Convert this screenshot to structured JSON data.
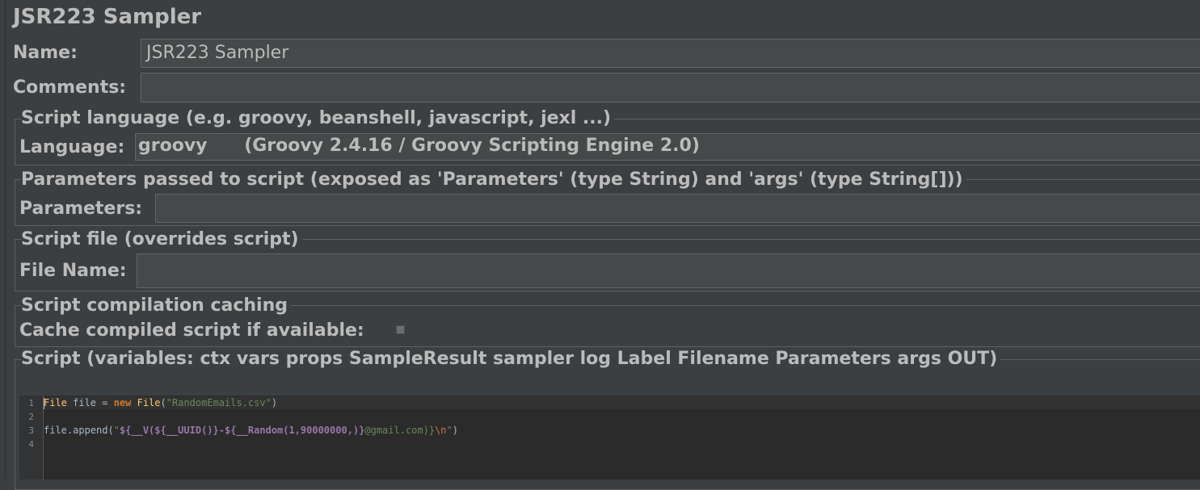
{
  "title": "JSR223 Sampler",
  "name": {
    "label": "Name:",
    "value": "JSR223 Sampler"
  },
  "comments": {
    "label": "Comments:",
    "value": ""
  },
  "language_group": {
    "legend": "Script language (e.g. groovy, beanshell, javascript, jexl ...)",
    "label": "Language:",
    "value": "groovy",
    "engine": "(Groovy 2.4.16 / Groovy Scripting Engine 2.0)"
  },
  "parameters_group": {
    "legend": "Parameters passed to script (exposed as 'Parameters' (type String) and 'args' (type String[]))",
    "label": "Parameters:",
    "value": ""
  },
  "script_file_group": {
    "legend": "Script file (overrides script)",
    "label": "File Name:",
    "value": ""
  },
  "caching_group": {
    "legend": "Script compilation caching",
    "label": "Cache compiled script if available:",
    "checked": false
  },
  "script_group": {
    "legend": "Script (variables: ctx vars props SampleResult sampler log Label Filename Parameters args OUT)"
  },
  "editor": {
    "line_numbers": [
      "1",
      "2",
      "3",
      "4"
    ],
    "line1": {
      "t1": "File",
      "t2": " file = ",
      "t3": "new",
      "t4": " ",
      "t5": "File",
      "t6": "(",
      "t7": "\"RandomEmails.csv\"",
      "t8": ")"
    },
    "line3": {
      "t1": "file.append(",
      "t2": "\"",
      "t3": "${__V(${__UUID()}-${__Random(1,90000000,)}",
      "t4": "@gmail.com)}",
      "t5": "\\n",
      "t6": "\"",
      "t7": ")"
    }
  },
  "colors": {
    "background": "#3c3f41",
    "field": "#45494a",
    "editor_bg": "#2b2b2b",
    "keyword": "#cc7832",
    "string": "#6a8759",
    "variable": "#9876aa"
  }
}
